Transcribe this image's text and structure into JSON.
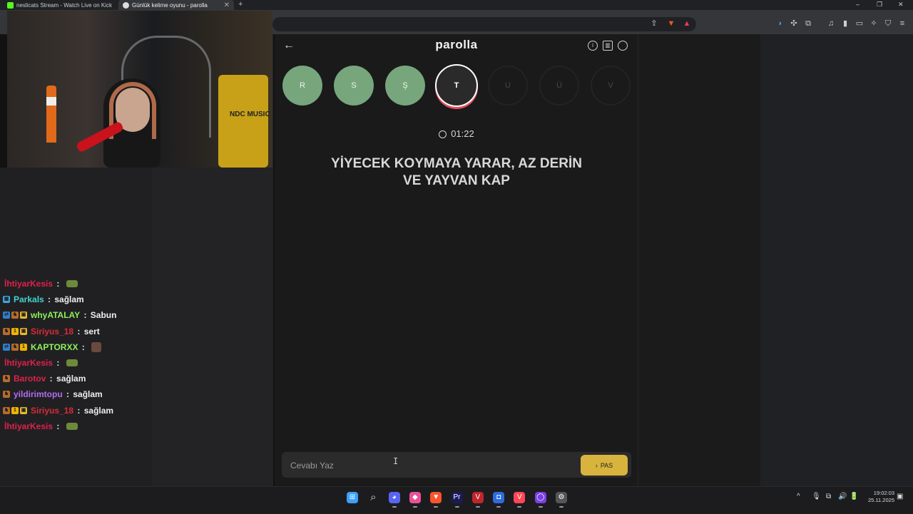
{
  "browser": {
    "tabs": [
      {
        "title": "neslicats Stream - Watch Live on Kick",
        "favicon_color": "#53fc18",
        "active": false
      },
      {
        "title": "Günlük kelime oyunu - parolla",
        "favicon_color": "#dddddd",
        "active": true
      }
    ],
    "new_tab_glyph": "+",
    "window_controls": [
      "–",
      "❐",
      "✕"
    ],
    "toolbar_icons": [
      "share-icon",
      "brave-shield-icon",
      "brave-rewards-icon",
      "extensions-icon",
      "music-icon",
      "sidebar-icon",
      "wallet-icon",
      "leo-icon",
      "vpn-icon",
      "menu-icon"
    ]
  },
  "webcam": {
    "barrel_text": "NDC MUSIC"
  },
  "chat": {
    "messages": [
      {
        "user": "İhtiyarKesis",
        "color": "#e0204a",
        "badges": [],
        "text": "",
        "emote": "tank-emote"
      },
      {
        "user": "Parkals",
        "color": "#41d6cf",
        "badges": [
          {
            "c": "#3ba8e0",
            "g": "▦"
          }
        ],
        "text": "sağlam"
      },
      {
        "user": "whyATALAY",
        "color": "#8df05a",
        "badges": [
          {
            "c": "#2f7fd1",
            "g": "⇄"
          },
          {
            "c": "#b86b2a",
            "g": "♞"
          },
          {
            "c": "#e7b82c",
            "g": "▣"
          }
        ],
        "text": "Sabun"
      },
      {
        "user": "Siriyus_18",
        "color": "#d92b3a",
        "badges": [
          {
            "c": "#b86b2a",
            "g": "♞"
          },
          {
            "c": "#f0b400",
            "g": "1"
          },
          {
            "c": "#e7b82c",
            "g": "▣"
          }
        ],
        "text": "sert"
      },
      {
        "user": "KAPTORXX",
        "color": "#8df05a",
        "badges": [
          {
            "c": "#2f7fd1",
            "g": "⇄"
          },
          {
            "c": "#b86b2a",
            "g": "♞"
          },
          {
            "c": "#f0b400",
            "g": "1"
          }
        ],
        "text": "",
        "emote": "face-emote"
      },
      {
        "user": "İhtiyarKesis",
        "color": "#e0204a",
        "badges": [],
        "text": "",
        "emote": "tank-emote"
      },
      {
        "user": "Barotov",
        "color": "#e0204a",
        "badges": [
          {
            "c": "#b86b2a",
            "g": "♞"
          }
        ],
        "text": "sağlam"
      },
      {
        "user": "yildirimtopu",
        "color": "#b46cf0",
        "badges": [
          {
            "c": "#b86b2a",
            "g": "♞"
          }
        ],
        "text": "sağlam"
      },
      {
        "user": "Siriyus_18",
        "color": "#d92b3a",
        "badges": [
          {
            "c": "#b86b2a",
            "g": "♞"
          },
          {
            "c": "#f0b400",
            "g": "1"
          },
          {
            "c": "#e7b82c",
            "g": "▣"
          }
        ],
        "text": "sağlam"
      },
      {
        "user": "İhtiyarKesis",
        "color": "#e0204a",
        "badges": [],
        "text": "",
        "emote": "tank-emote"
      }
    ]
  },
  "game": {
    "title": "parolla",
    "back_glyph": "←",
    "header_icons": [
      {
        "name": "info-icon",
        "glyph": "i"
      },
      {
        "name": "stats-icon",
        "glyph": "▥"
      },
      {
        "name": "profile-icon",
        "glyph": "◉"
      }
    ],
    "letters": [
      {
        "char": "R",
        "state": "done"
      },
      {
        "char": "S",
        "state": "done"
      },
      {
        "char": "Ş",
        "state": "done"
      },
      {
        "char": "T",
        "state": "current"
      },
      {
        "char": "U",
        "state": "todo"
      },
      {
        "char": "Ü",
        "state": "todo"
      },
      {
        "char": "V",
        "state": "todo"
      }
    ],
    "timer": "01:22",
    "clue_line1": "YİYECEK KOYMAYA YARAR, AZ DERİN",
    "clue_line2": "VE YAYVAN KAP",
    "input_placeholder": "Cevabı Yaz",
    "pass_label": "PAS",
    "pass_glyph": "›",
    "cursor_glyph": "I"
  },
  "taskbar": {
    "apps": [
      {
        "name": "windows-start-icon",
        "glyph": "⊞",
        "color": "#3aa0ff"
      },
      {
        "name": "search-icon",
        "glyph": "⌕",
        "color": "transparent"
      },
      {
        "name": "discord-icon",
        "glyph": "◕",
        "color": "#5865f2"
      },
      {
        "name": "photos-icon",
        "glyph": "◆",
        "color": "#e8529a"
      },
      {
        "name": "brave-icon",
        "glyph": "▼",
        "color": "#fb542b"
      },
      {
        "name": "premiere-icon",
        "glyph": "Pr",
        "color": "#1a1a5a"
      },
      {
        "name": "valorant-icon",
        "glyph": "V",
        "color": "#c0262d"
      },
      {
        "name": "app-blue-icon",
        "glyph": "◘",
        "color": "#2d6cdf"
      },
      {
        "name": "valorant-2-icon",
        "glyph": "V",
        "color": "#ff4655"
      },
      {
        "name": "obs-like-icon",
        "glyph": "◯",
        "color": "#7b3fe4"
      },
      {
        "name": "steam-like-icon",
        "glyph": "⚙",
        "color": "#555555"
      }
    ],
    "tray_icons": [
      "^",
      "🎙",
      "⧉",
      "🔊",
      "🔋"
    ],
    "time": "19:02:03",
    "date": "25.11.2025"
  }
}
